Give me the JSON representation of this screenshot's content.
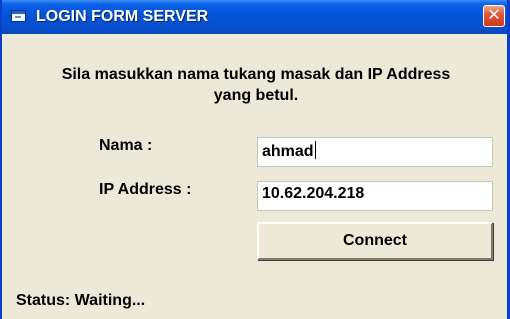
{
  "window": {
    "title": "LOGIN FORM SERVER",
    "close_label": "✕"
  },
  "form": {
    "instruction_line1": "Sila masukkan nama tukang masak dan IP Address",
    "instruction_line2": "yang betul.",
    "name_label": "Nama :",
    "name_value": "ahmad",
    "ip_label": "IP Address :",
    "ip_value": "10.62.204.218",
    "connect_label": "Connect"
  },
  "status": {
    "text": "Status: Waiting..."
  },
  "colors": {
    "titlebar": "#0553d6",
    "window_bg": "#ece9d8",
    "close_button": "#e0583a"
  }
}
